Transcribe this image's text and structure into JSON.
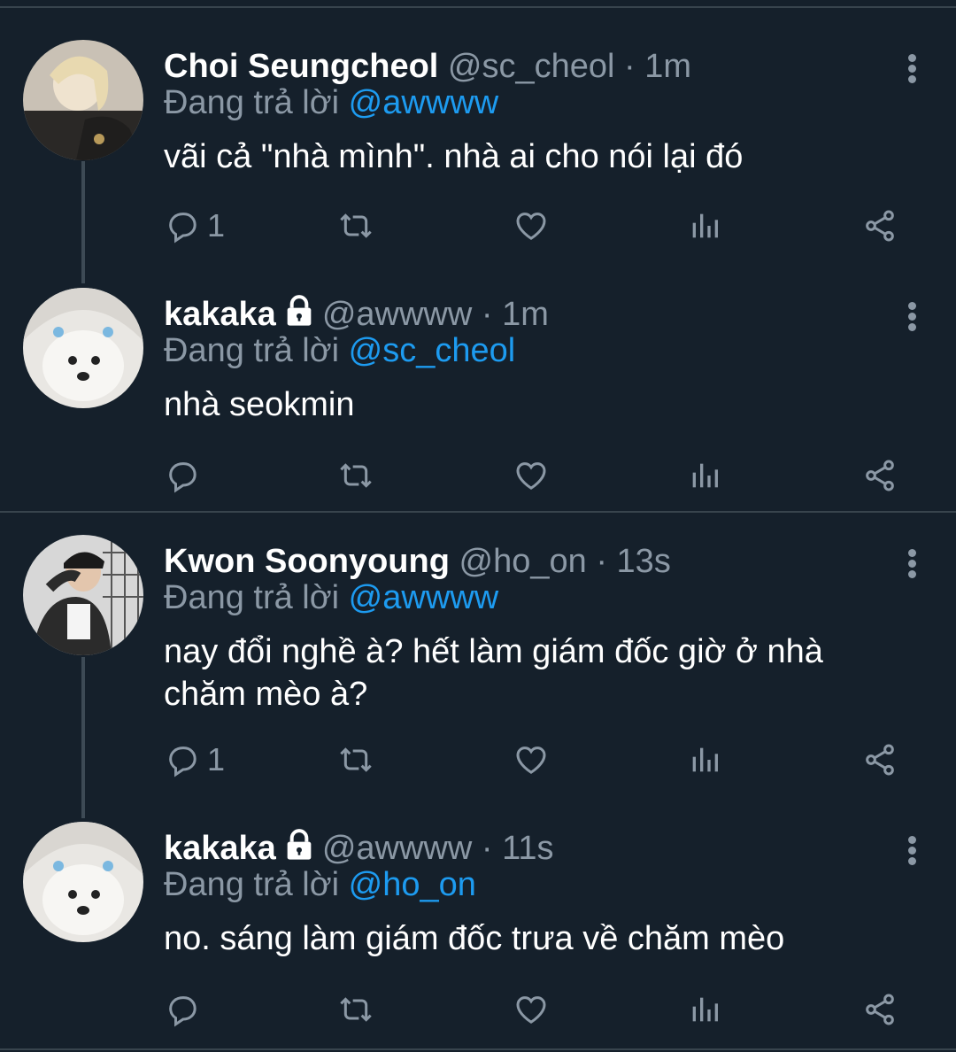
{
  "colors": {
    "background": "#15202b",
    "text_primary": "#ffffff",
    "text_secondary": "#8b98a5",
    "accent": "#1d9bf0",
    "divider": "#38444d"
  },
  "tweets": [
    {
      "name": "Choi Seungcheol",
      "handle": "@sc_cheol",
      "dot": "·",
      "time": "1m",
      "reply_prefix": "Đang trả lời",
      "reply_to": "@awwww",
      "text": "vãi cả \"nhà mình\". nhà ai cho nói lại đó",
      "reply_count": "1",
      "locked": false,
      "avatar_icon": "person-avatar"
    },
    {
      "name": "kakaka",
      "handle": "@awwww",
      "dot": "·",
      "time": "1m",
      "reply_prefix": "Đang trả lời",
      "reply_to": "@sc_cheol",
      "text": "nhà seokmin",
      "reply_count": "",
      "locked": true,
      "avatar_icon": "dog-avatar"
    },
    {
      "name": "Kwon Soonyoung",
      "handle": "@ho_on",
      "dot": "·",
      "time": "13s",
      "reply_prefix": "Đang trả lời",
      "reply_to": "@awwww",
      "text": "nay đổi nghề à? hết làm giám đốc giờ ở nhà chăm mèo à?",
      "reply_count": "1",
      "locked": false,
      "avatar_icon": "person-avatar"
    },
    {
      "name": "kakaka",
      "handle": "@awwww",
      "dot": "·",
      "time": "11s",
      "reply_prefix": "Đang trả lời",
      "reply_to": "@ho_on",
      "text": "no. sáng làm giám đốc trưa về chăm mèo",
      "reply_count": "",
      "locked": true,
      "avatar_icon": "dog-avatar"
    }
  ],
  "icons": {
    "reply": "reply-icon",
    "retweet": "retweet-icon",
    "like": "heart-icon",
    "analytics": "analytics-icon",
    "share": "share-icon",
    "more": "more-icon",
    "lock": "lock-icon"
  }
}
